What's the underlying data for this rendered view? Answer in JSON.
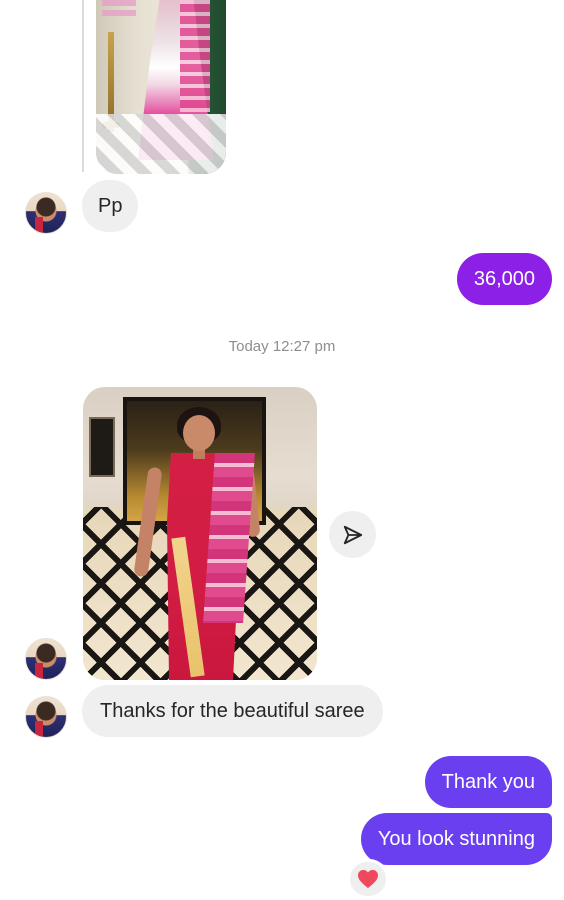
{
  "thread": {
    "timestamp": "Today 12:27 pm",
    "messages": {
      "pp": "Pp",
      "price": "36,000",
      "thanks": "Thanks for the beautiful saree",
      "thank_you": "Thank you",
      "stunning": "You look stunning"
    },
    "reaction_emoji": "heart-icon"
  },
  "colors": {
    "incoming_bubble": "#efefef",
    "outgoing_price_bubble": "#8c20e6",
    "outgoing_bubble": "#6a3ff0",
    "timestamp": "#8e8e8e"
  }
}
